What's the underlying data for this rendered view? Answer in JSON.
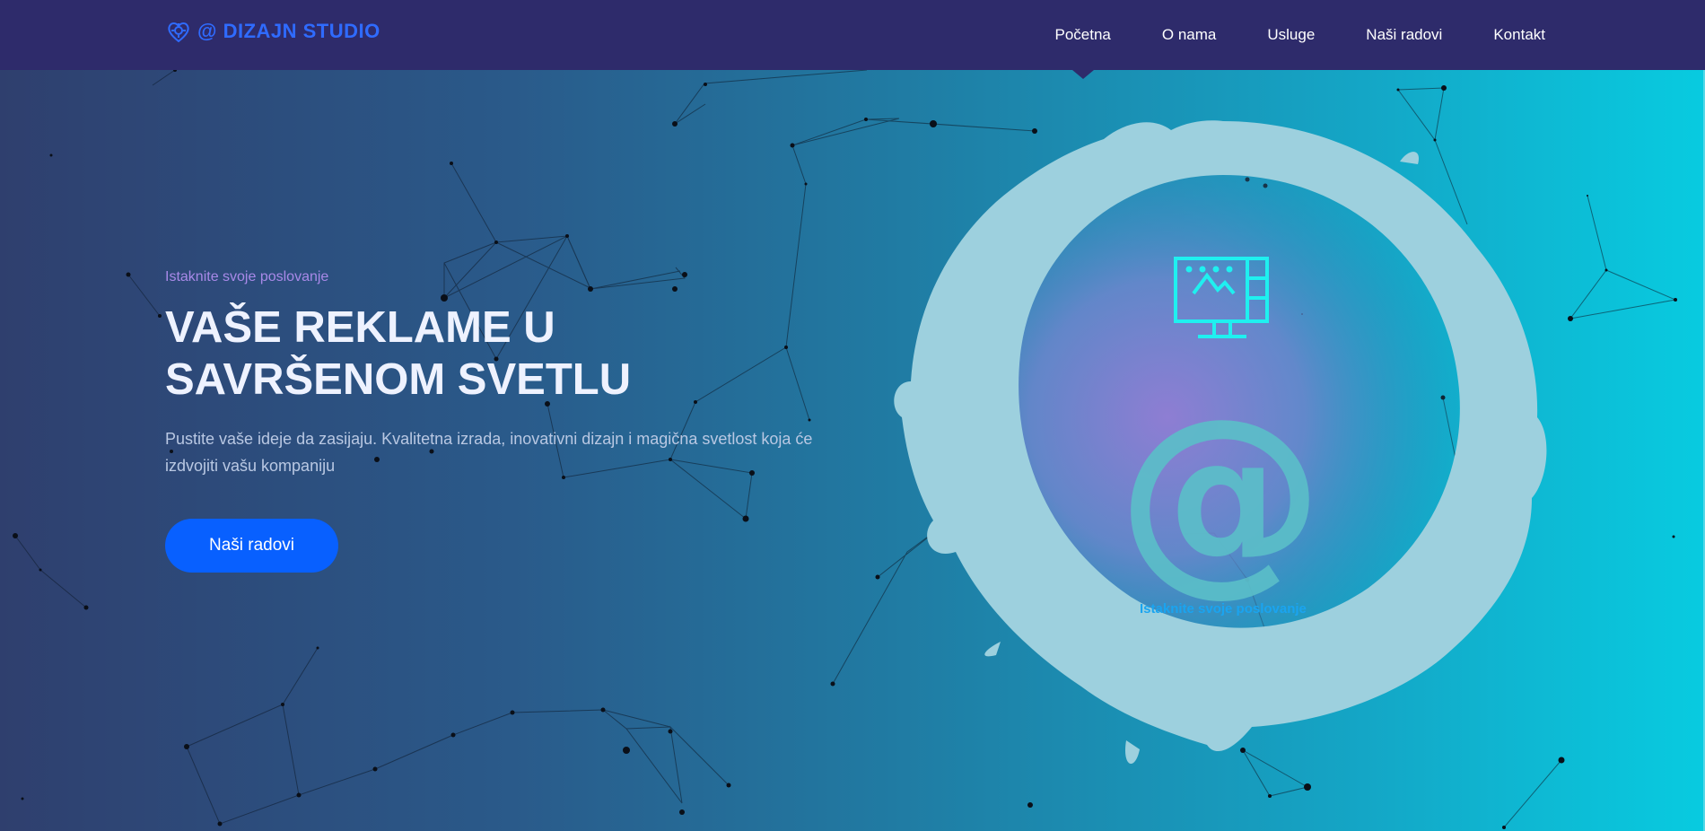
{
  "brand": {
    "name": "@ DIZAJN STUDIO",
    "logo_icon": "heart-gear-icon",
    "color": "#2f6bff"
  },
  "nav": {
    "items": [
      {
        "label": "Početna",
        "active": true
      },
      {
        "label": "O nama"
      },
      {
        "label": "Usluge"
      },
      {
        "label": "Naši radovi"
      },
      {
        "label": "Kontakt"
      }
    ],
    "background": "#2e2b6b"
  },
  "hero": {
    "kicker": "Istaknite svoje poslovanje",
    "headline_line1": "VAŠE REKLAME U",
    "headline_line2": "SAVRŠENOM SVETLU",
    "lead": "Pustite vaše ideje da zasijaju. Kvalitetna izrada, inovativni dizajn i magična svetlost koja će izdvojiti vašu kompaniju",
    "cta_label": "Naši radovi",
    "cta_color": "#0860ff"
  },
  "illustration": {
    "icon": "monitor-image-icon",
    "symbol": "@",
    "caption": "Istaknite svoje poslovanje"
  }
}
